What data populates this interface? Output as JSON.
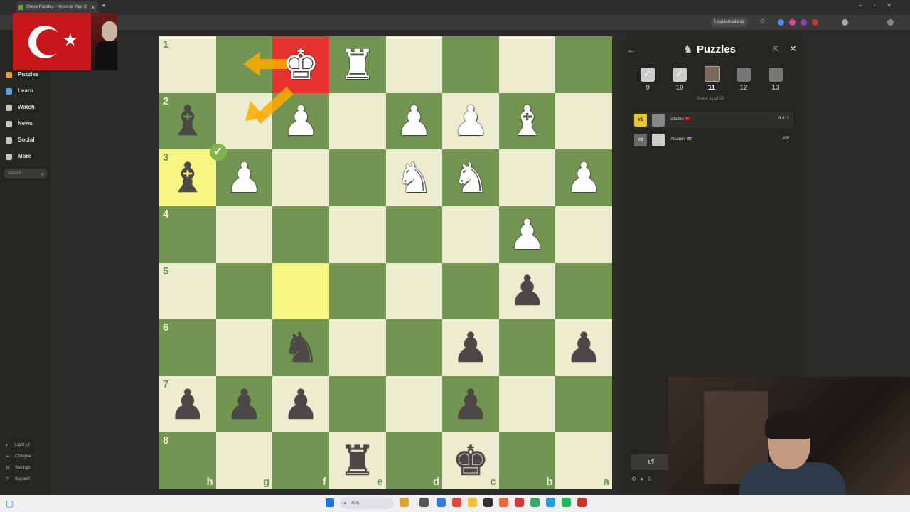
{
  "browser": {
    "tab_title": "Chess Puzzles - Improve Your C",
    "open_in_app": "Uygulamada aç"
  },
  "nav": {
    "items": [
      {
        "label": "Puzzles",
        "color": "#e8a23a"
      },
      {
        "label": "Learn",
        "color": "#5aa0d8"
      },
      {
        "label": "Watch",
        "color": "#c4c4c4"
      },
      {
        "label": "News",
        "color": "#c4c4c4"
      },
      {
        "label": "Social",
        "color": "#c4c4c4"
      },
      {
        "label": "More",
        "color": "#c4c4c4"
      }
    ],
    "search_placeholder": "Search",
    "footer": [
      {
        "label": "Light UI",
        "icon": "◐"
      },
      {
        "label": "Collapse",
        "icon": "⇤"
      },
      {
        "label": "Settings",
        "icon": "⚙"
      },
      {
        "label": "Support",
        "icon": "?"
      }
    ]
  },
  "board": {
    "rank_labels": [
      "1",
      "2",
      "3",
      "4",
      "5",
      "6",
      "7",
      "8"
    ],
    "file_labels": [
      "h",
      "g",
      "f",
      "e",
      "d",
      "c",
      "b",
      "a"
    ],
    "colors": {
      "light": "#ebecd0",
      "dark": "#739552",
      "check": "#e8322e",
      "lastmove": "#f5f682"
    },
    "pieces": [
      {
        "glyph": "♚",
        "side": "w",
        "row": 0,
        "col": 2,
        "name": "white-king"
      },
      {
        "glyph": "♜",
        "side": "w",
        "row": 0,
        "col": 3,
        "name": "white-rook"
      },
      {
        "glyph": "♝",
        "side": "b",
        "row": 1,
        "col": 0,
        "name": "black-bishop"
      },
      {
        "glyph": "♟",
        "side": "w",
        "row": 1,
        "col": 2,
        "name": "white-pawn"
      },
      {
        "glyph": "♟",
        "side": "w",
        "row": 1,
        "col": 4,
        "name": "white-pawn"
      },
      {
        "glyph": "♟",
        "side": "w",
        "row": 1,
        "col": 5,
        "name": "white-pawn"
      },
      {
        "glyph": "♝",
        "side": "w",
        "row": 1,
        "col": 6,
        "name": "white-bishop"
      },
      {
        "glyph": "♝",
        "side": "b",
        "row": 2,
        "col": 0,
        "name": "black-bishop"
      },
      {
        "glyph": "♟",
        "side": "w",
        "row": 2,
        "col": 1,
        "name": "white-pawn"
      },
      {
        "glyph": "♞",
        "side": "w",
        "row": 2,
        "col": 4,
        "name": "white-knight"
      },
      {
        "glyph": "♞",
        "side": "w",
        "row": 2,
        "col": 5,
        "name": "white-knight"
      },
      {
        "glyph": "♟",
        "side": "w",
        "row": 2,
        "col": 7,
        "name": "white-pawn"
      },
      {
        "glyph": "♟",
        "side": "w",
        "row": 3,
        "col": 6,
        "name": "white-pawn"
      },
      {
        "glyph": "♟",
        "side": "b",
        "row": 4,
        "col": 6,
        "name": "black-pawn"
      },
      {
        "glyph": "♞",
        "side": "b",
        "row": 5,
        "col": 2,
        "name": "black-knight"
      },
      {
        "glyph": "♟",
        "side": "b",
        "row": 5,
        "col": 5,
        "name": "black-pawn"
      },
      {
        "glyph": "♟",
        "side": "b",
        "row": 5,
        "col": 7,
        "name": "black-pawn"
      },
      {
        "glyph": "♟",
        "side": "b",
        "row": 6,
        "col": 0,
        "name": "black-pawn"
      },
      {
        "glyph": "♟",
        "side": "b",
        "row": 6,
        "col": 1,
        "name": "black-pawn"
      },
      {
        "glyph": "♟",
        "side": "b",
        "row": 6,
        "col": 2,
        "name": "black-pawn"
      },
      {
        "glyph": "♟",
        "side": "b",
        "row": 6,
        "col": 5,
        "name": "black-pawn"
      },
      {
        "glyph": "♜",
        "side": "b",
        "row": 7,
        "col": 3,
        "name": "black-rook"
      },
      {
        "glyph": "♚",
        "side": "b",
        "row": 7,
        "col": 5,
        "name": "black-king"
      }
    ],
    "highlights": [
      {
        "row": 0,
        "col": 2,
        "type": "check"
      },
      {
        "row": 2,
        "col": 0,
        "type": "lastmove"
      },
      {
        "row": 4,
        "col": 2,
        "type": "lastmove"
      }
    ]
  },
  "panel": {
    "title": "Puzzles",
    "steps": [
      {
        "num": "9",
        "state": "done"
      },
      {
        "num": "10",
        "state": "done"
      },
      {
        "num": "11",
        "state": "current"
      },
      {
        "num": "12",
        "state": "todo"
      },
      {
        "num": "13",
        "state": "todo"
      }
    ],
    "caption": "Stone 11 of 20",
    "leaderboard": [
      {
        "rank": "#1",
        "name": "sifadze 🇹🇷",
        "score": "9,312",
        "rank_color": "#e8c43a"
      },
      {
        "rank": "#2",
        "name": "Alcanov 🇦🇿",
        "score": "205",
        "rank_color": "#8a8a8a"
      }
    ]
  },
  "taskbar": {
    "search_placeholder": "Ara"
  }
}
